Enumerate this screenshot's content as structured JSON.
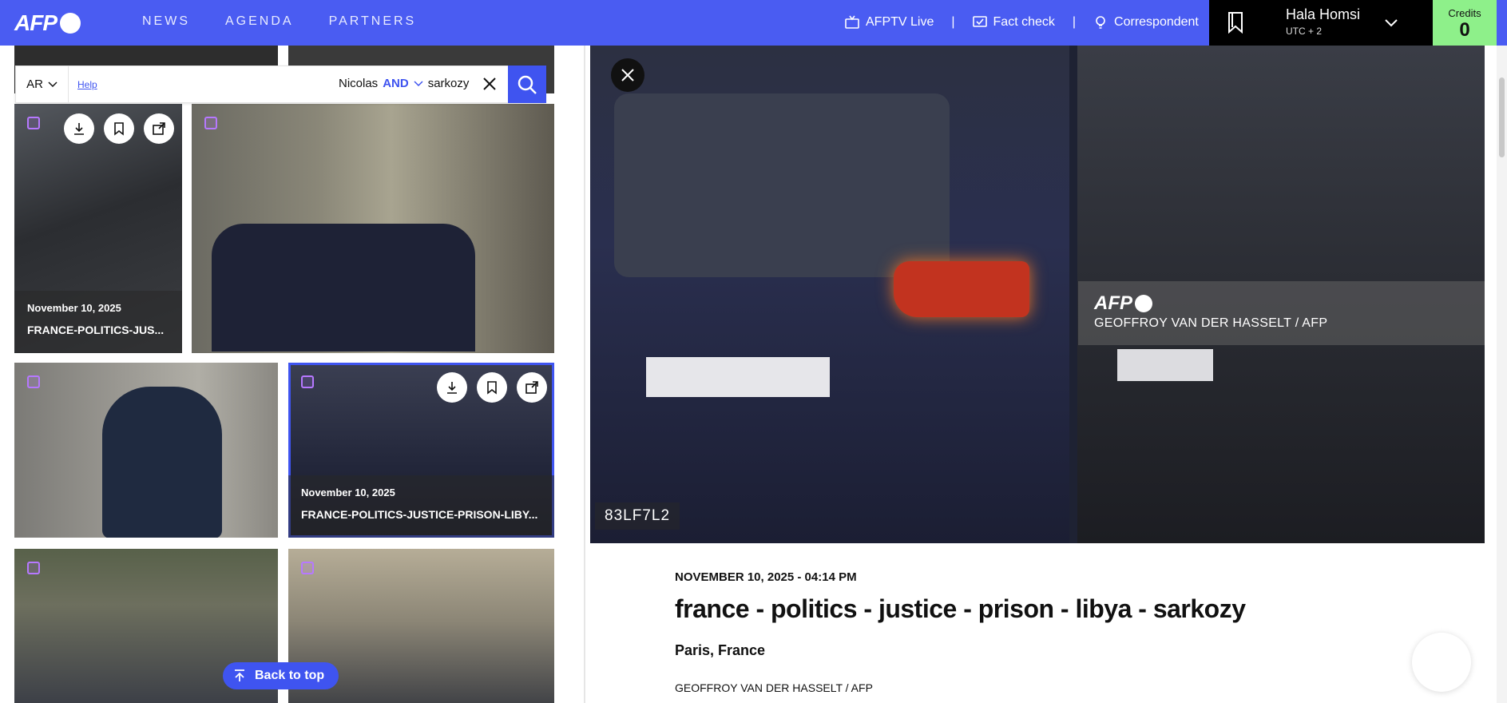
{
  "brand": {
    "logo_text": "AFP"
  },
  "nav": {
    "items": [
      "NEWS",
      "AGENDA",
      "PARTNERS"
    ]
  },
  "header_links": {
    "afptv": "AFPTV Live",
    "factcheck": "Fact check",
    "correspondent": "Correspondent",
    "separator": "|"
  },
  "user": {
    "name": "Hala Homsi",
    "timezone": "UTC + 2"
  },
  "credits": {
    "label": "Credits",
    "value": "0"
  },
  "search": {
    "language": "AR",
    "help": "Help",
    "term1": "Nicolas",
    "operator": "AND",
    "term2": "sarkozy"
  },
  "results": [
    {
      "date": "November 10, 2025",
      "title": "FRANCE-POLITICS-JUS..."
    },
    {
      "date": "November 10, 2025",
      "title": "FRANCE-POLITICS-JUSTICE-PRISON-LIBY..."
    }
  ],
  "back_to_top": "Back to top",
  "detail": {
    "credit_logo": "AFP",
    "credit_line": "GEOFFROY VAN DER HASSELT / AFP",
    "ref": "83LF7L2",
    "datetime": "NOVEMBER 10, 2025 - 04:14 PM",
    "title": "france - politics - justice - prison - libya - sarkozy",
    "location": "Paris, France",
    "byline": "GEOFFROY VAN DER HASSELT / AFP"
  },
  "colors": {
    "brand": "#4a5cf2",
    "accent": "#3f54f0",
    "credits_bg": "#8ef08a"
  }
}
